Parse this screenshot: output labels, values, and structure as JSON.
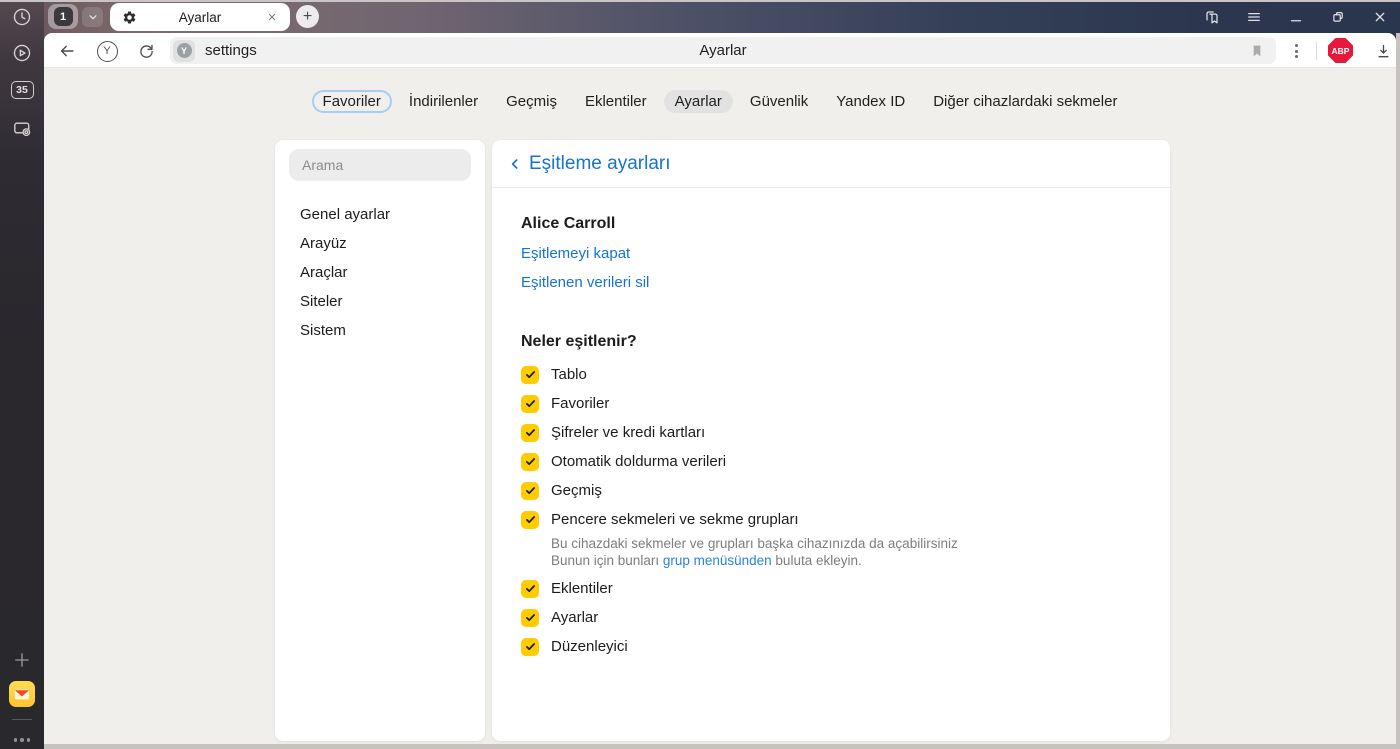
{
  "colors": {
    "accent_blue": "#1673d1",
    "checkbox_yellow": "#ffcc00",
    "abp_red": "#e5193c"
  },
  "titlebar": {
    "tab_group_count": "1",
    "tab_title": "Ayarlar",
    "new_tab_glyph": "+"
  },
  "sidebar": {
    "tab_counter": "35"
  },
  "toolbar": {
    "url_text": "settings",
    "page_title": "Ayarlar",
    "extension_label": "ABP"
  },
  "nav_tabs": {
    "items": [
      {
        "label": "Favoriler"
      },
      {
        "label": "İndirilenler"
      },
      {
        "label": "Geçmiş"
      },
      {
        "label": "Eklentiler"
      },
      {
        "label": "Ayarlar"
      },
      {
        "label": "Güvenlik"
      },
      {
        "label": "Yandex ID"
      },
      {
        "label": "Diğer cihazlardaki sekmeler"
      }
    ]
  },
  "settings_nav": {
    "search_placeholder": "Arama",
    "items": [
      {
        "label": "Genel ayarlar"
      },
      {
        "label": "Arayüz"
      },
      {
        "label": "Araçlar"
      },
      {
        "label": "Siteler"
      },
      {
        "label": "Sistem"
      }
    ]
  },
  "sync": {
    "title": "Eşitleme ayarları",
    "account_name": "Alice Carroll",
    "link_disable": "Eşitlemeyi kapat",
    "link_delete": "Eşitlenen verileri sil",
    "section_title": "Neler eşitlenir?",
    "items": [
      {
        "label": "Tablo",
        "checked": true
      },
      {
        "label": "Favoriler",
        "checked": true
      },
      {
        "label": "Şifreler ve kredi kartları",
        "checked": true
      },
      {
        "label": "Otomatik doldurma verileri",
        "checked": true
      },
      {
        "label": "Geçmiş",
        "checked": true
      },
      {
        "label": "Pencere sekmeleri ve sekme grupları",
        "checked": true,
        "desc_line1": "Bu cihazdaki sekmeler ve grupları başka cihazınızda da açabilirsiniz",
        "desc_line2_before": "Bunun için bunları ",
        "desc_link": "grup menüsünden",
        "desc_line2_after": " buluta ekleyin."
      },
      {
        "label": "Eklentiler",
        "checked": true
      },
      {
        "label": "Ayarlar",
        "checked": true
      },
      {
        "label": "Düzenleyici",
        "checked": true
      }
    ]
  }
}
